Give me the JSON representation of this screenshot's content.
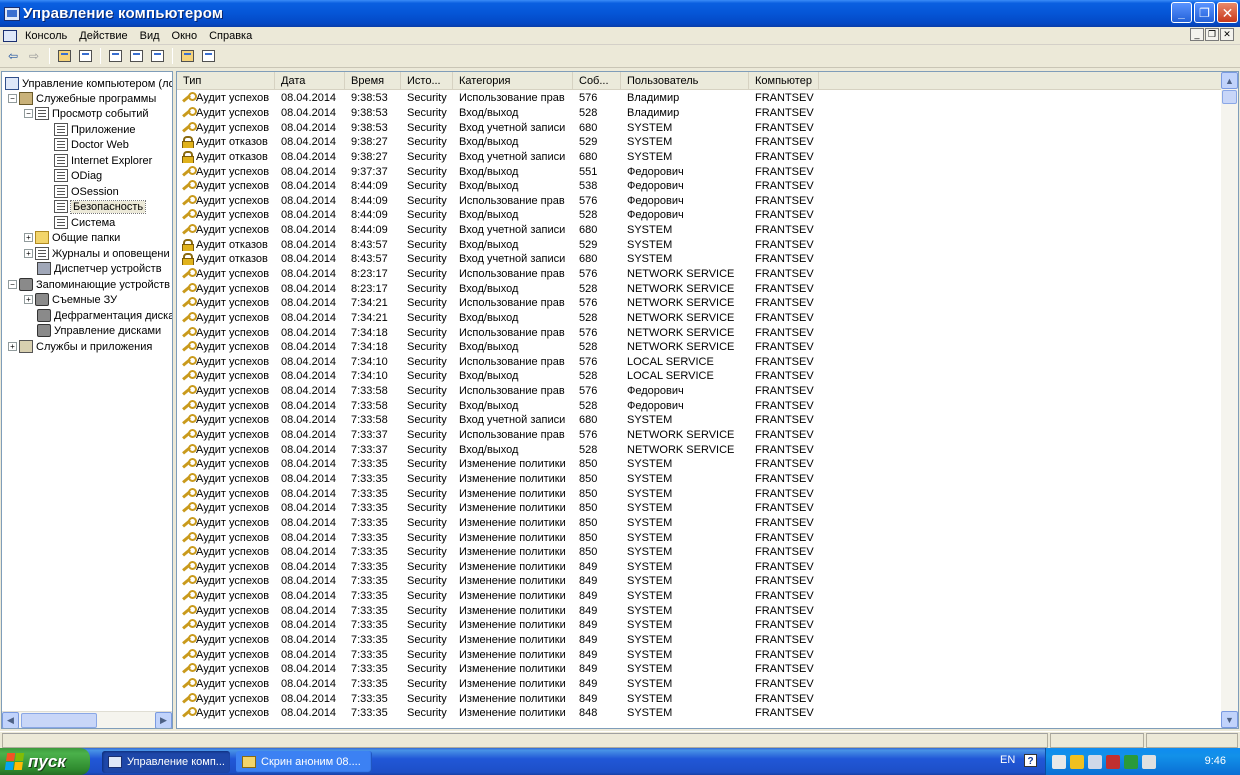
{
  "window": {
    "title": "Управление компьютером"
  },
  "menu": {
    "items": [
      "Консоль",
      "Действие",
      "Вид",
      "Окно",
      "Справка"
    ]
  },
  "toolbar": {
    "buttons": [
      "back-icon",
      "forward-icon",
      "up-folder-icon",
      "show-hide-tree-icon",
      "properties-icon",
      "refresh-icon",
      "export-icon",
      "help-icon",
      "new-window-icon"
    ]
  },
  "tree": {
    "root": "Управление компьютером (лок",
    "system_tools": "Служебные программы",
    "event_viewer": "Просмотр событий",
    "logs": [
      "Приложение",
      "Doctor Web",
      "Internet Explorer",
      "ODiag",
      "OSession",
      "Безопасность",
      "Система"
    ],
    "shared_folders": "Общие папки",
    "perf_logs": "Журналы и оповещени",
    "device_manager": "Диспетчер устройств",
    "storage": "Запоминающие устройств",
    "removable": "Съемные ЗУ",
    "defrag": "Дефрагментация диска",
    "disk_mgmt": "Управление дисками",
    "services": "Службы и приложения",
    "selected": "Безопасность"
  },
  "list": {
    "columns": [
      "Тип",
      "Дата",
      "Время",
      "Исто...",
      "Категория",
      "Соб...",
      "Пользователь",
      "Компьютер"
    ],
    "rows": [
      [
        "key",
        "Аудит успехов",
        "08.04.2014",
        "9:38:53",
        "Security",
        "Использование прав",
        "576",
        "Владимир",
        "FRANTSEV"
      ],
      [
        "key",
        "Аудит успехов",
        "08.04.2014",
        "9:38:53",
        "Security",
        "Вход/выход",
        "528",
        "Владимир",
        "FRANTSEV"
      ],
      [
        "key",
        "Аудит успехов",
        "08.04.2014",
        "9:38:53",
        "Security",
        "Вход учетной записи",
        "680",
        "SYSTEM",
        "FRANTSEV"
      ],
      [
        "lock",
        "Аудит отказов",
        "08.04.2014",
        "9:38:27",
        "Security",
        "Вход/выход",
        "529",
        "SYSTEM",
        "FRANTSEV"
      ],
      [
        "lock",
        "Аудит отказов",
        "08.04.2014",
        "9:38:27",
        "Security",
        "Вход учетной записи",
        "680",
        "SYSTEM",
        "FRANTSEV"
      ],
      [
        "key",
        "Аудит успехов",
        "08.04.2014",
        "9:37:37",
        "Security",
        "Вход/выход",
        "551",
        "Федорович",
        "FRANTSEV"
      ],
      [
        "key",
        "Аудит успехов",
        "08.04.2014",
        "8:44:09",
        "Security",
        "Вход/выход",
        "538",
        "Федорович",
        "FRANTSEV"
      ],
      [
        "key",
        "Аудит успехов",
        "08.04.2014",
        "8:44:09",
        "Security",
        "Использование прав",
        "576",
        "Федорович",
        "FRANTSEV"
      ],
      [
        "key",
        "Аудит успехов",
        "08.04.2014",
        "8:44:09",
        "Security",
        "Вход/выход",
        "528",
        "Федорович",
        "FRANTSEV"
      ],
      [
        "key",
        "Аудит успехов",
        "08.04.2014",
        "8:44:09",
        "Security",
        "Вход учетной записи",
        "680",
        "SYSTEM",
        "FRANTSEV"
      ],
      [
        "lock",
        "Аудит отказов",
        "08.04.2014",
        "8:43:57",
        "Security",
        "Вход/выход",
        "529",
        "SYSTEM",
        "FRANTSEV"
      ],
      [
        "lock",
        "Аудит отказов",
        "08.04.2014",
        "8:43:57",
        "Security",
        "Вход учетной записи",
        "680",
        "SYSTEM",
        "FRANTSEV"
      ],
      [
        "key",
        "Аудит успехов",
        "08.04.2014",
        "8:23:17",
        "Security",
        "Использование прав",
        "576",
        "NETWORK SERVICE",
        "FRANTSEV"
      ],
      [
        "key",
        "Аудит успехов",
        "08.04.2014",
        "8:23:17",
        "Security",
        "Вход/выход",
        "528",
        "NETWORK SERVICE",
        "FRANTSEV"
      ],
      [
        "key",
        "Аудит успехов",
        "08.04.2014",
        "7:34:21",
        "Security",
        "Использование прав",
        "576",
        "NETWORK SERVICE",
        "FRANTSEV"
      ],
      [
        "key",
        "Аудит успехов",
        "08.04.2014",
        "7:34:21",
        "Security",
        "Вход/выход",
        "528",
        "NETWORK SERVICE",
        "FRANTSEV"
      ],
      [
        "key",
        "Аудит успехов",
        "08.04.2014",
        "7:34:18",
        "Security",
        "Использование прав",
        "576",
        "NETWORK SERVICE",
        "FRANTSEV"
      ],
      [
        "key",
        "Аудит успехов",
        "08.04.2014",
        "7:34:18",
        "Security",
        "Вход/выход",
        "528",
        "NETWORK SERVICE",
        "FRANTSEV"
      ],
      [
        "key",
        "Аудит успехов",
        "08.04.2014",
        "7:34:10",
        "Security",
        "Использование прав",
        "576",
        "LOCAL SERVICE",
        "FRANTSEV"
      ],
      [
        "key",
        "Аудит успехов",
        "08.04.2014",
        "7:34:10",
        "Security",
        "Вход/выход",
        "528",
        "LOCAL SERVICE",
        "FRANTSEV"
      ],
      [
        "key",
        "Аудит успехов",
        "08.04.2014",
        "7:33:58",
        "Security",
        "Использование прав",
        "576",
        "Федорович",
        "FRANTSEV"
      ],
      [
        "key",
        "Аудит успехов",
        "08.04.2014",
        "7:33:58",
        "Security",
        "Вход/выход",
        "528",
        "Федорович",
        "FRANTSEV"
      ],
      [
        "key",
        "Аудит успехов",
        "08.04.2014",
        "7:33:58",
        "Security",
        "Вход учетной записи",
        "680",
        "SYSTEM",
        "FRANTSEV"
      ],
      [
        "key",
        "Аудит успехов",
        "08.04.2014",
        "7:33:37",
        "Security",
        "Использование прав",
        "576",
        "NETWORK SERVICE",
        "FRANTSEV"
      ],
      [
        "key",
        "Аудит успехов",
        "08.04.2014",
        "7:33:37",
        "Security",
        "Вход/выход",
        "528",
        "NETWORK SERVICE",
        "FRANTSEV"
      ],
      [
        "key",
        "Аудит успехов",
        "08.04.2014",
        "7:33:35",
        "Security",
        "Изменение политики",
        "850",
        "SYSTEM",
        "FRANTSEV"
      ],
      [
        "key",
        "Аудит успехов",
        "08.04.2014",
        "7:33:35",
        "Security",
        "Изменение политики",
        "850",
        "SYSTEM",
        "FRANTSEV"
      ],
      [
        "key",
        "Аудит успехов",
        "08.04.2014",
        "7:33:35",
        "Security",
        "Изменение политики",
        "850",
        "SYSTEM",
        "FRANTSEV"
      ],
      [
        "key",
        "Аудит успехов",
        "08.04.2014",
        "7:33:35",
        "Security",
        "Изменение политики",
        "850",
        "SYSTEM",
        "FRANTSEV"
      ],
      [
        "key",
        "Аудит успехов",
        "08.04.2014",
        "7:33:35",
        "Security",
        "Изменение политики",
        "850",
        "SYSTEM",
        "FRANTSEV"
      ],
      [
        "key",
        "Аудит успехов",
        "08.04.2014",
        "7:33:35",
        "Security",
        "Изменение политики",
        "850",
        "SYSTEM",
        "FRANTSEV"
      ],
      [
        "key",
        "Аудит успехов",
        "08.04.2014",
        "7:33:35",
        "Security",
        "Изменение политики",
        "850",
        "SYSTEM",
        "FRANTSEV"
      ],
      [
        "key",
        "Аудит успехов",
        "08.04.2014",
        "7:33:35",
        "Security",
        "Изменение политики",
        "849",
        "SYSTEM",
        "FRANTSEV"
      ],
      [
        "key",
        "Аудит успехов",
        "08.04.2014",
        "7:33:35",
        "Security",
        "Изменение политики",
        "849",
        "SYSTEM",
        "FRANTSEV"
      ],
      [
        "key",
        "Аудит успехов",
        "08.04.2014",
        "7:33:35",
        "Security",
        "Изменение политики",
        "849",
        "SYSTEM",
        "FRANTSEV"
      ],
      [
        "key",
        "Аудит успехов",
        "08.04.2014",
        "7:33:35",
        "Security",
        "Изменение политики",
        "849",
        "SYSTEM",
        "FRANTSEV"
      ],
      [
        "key",
        "Аудит успехов",
        "08.04.2014",
        "7:33:35",
        "Security",
        "Изменение политики",
        "849",
        "SYSTEM",
        "FRANTSEV"
      ],
      [
        "key",
        "Аудит успехов",
        "08.04.2014",
        "7:33:35",
        "Security",
        "Изменение политики",
        "849",
        "SYSTEM",
        "FRANTSEV"
      ],
      [
        "key",
        "Аудит успехов",
        "08.04.2014",
        "7:33:35",
        "Security",
        "Изменение политики",
        "849",
        "SYSTEM",
        "FRANTSEV"
      ],
      [
        "key",
        "Аудит успехов",
        "08.04.2014",
        "7:33:35",
        "Security",
        "Изменение политики",
        "849",
        "SYSTEM",
        "FRANTSEV"
      ],
      [
        "key",
        "Аудит успехов",
        "08.04.2014",
        "7:33:35",
        "Security",
        "Изменение политики",
        "849",
        "SYSTEM",
        "FRANTSEV"
      ],
      [
        "key",
        "Аудит успехов",
        "08.04.2014",
        "7:33:35",
        "Security",
        "Изменение политики",
        "849",
        "SYSTEM",
        "FRANTSEV"
      ],
      [
        "key",
        "Аудит успехов",
        "08.04.2014",
        "7:33:35",
        "Security",
        "Изменение политики",
        "848",
        "SYSTEM",
        "FRANTSEV"
      ]
    ]
  },
  "taskbar": {
    "start_label": "пуск",
    "tasks": [
      {
        "label": "Управление комп...",
        "icon": "computer-management-icon",
        "active": true
      },
      {
        "label": "Скрин аноним 08....",
        "icon": "document-icon",
        "active": false
      }
    ],
    "language": "EN",
    "help": "?",
    "clock": "9:46"
  }
}
